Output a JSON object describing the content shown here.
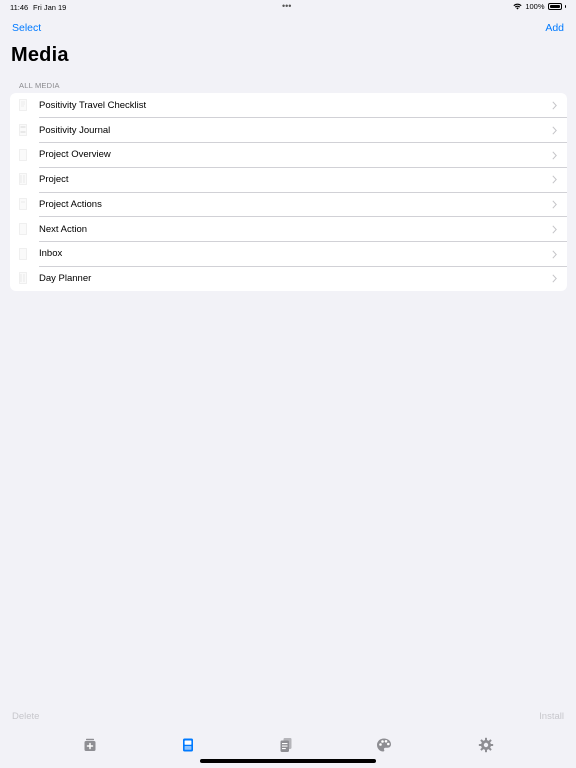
{
  "status_bar": {
    "time": "11:46",
    "date": "Fri Jan 19",
    "dots": "•••",
    "battery_percent": "100%"
  },
  "nav": {
    "select_label": "Select",
    "add_label": "Add",
    "title": "Media"
  },
  "section": {
    "header": "All Media",
    "items": [
      {
        "label": "Positivity Travel Checklist"
      },
      {
        "label": "Positivity Journal"
      },
      {
        "label": "Project Overview"
      },
      {
        "label": "Project"
      },
      {
        "label": "Project Actions"
      },
      {
        "label": "Next Action"
      },
      {
        "label": "Inbox"
      },
      {
        "label": "Day Planner"
      }
    ]
  },
  "bottom": {
    "delete_label": "Delete",
    "install_label": "Install"
  },
  "tabs": [
    {
      "icon": "tray-add-icon"
    },
    {
      "icon": "media-template-icon",
      "selected": true
    },
    {
      "icon": "stacked-pages-icon"
    },
    {
      "icon": "palette-icon"
    },
    {
      "icon": "gear-icon"
    }
  ],
  "colors": {
    "accent": "#007aff",
    "background": "#f2f2f7",
    "tab_inactive": "#8e8e93",
    "disabled": "#c7c7cc"
  }
}
